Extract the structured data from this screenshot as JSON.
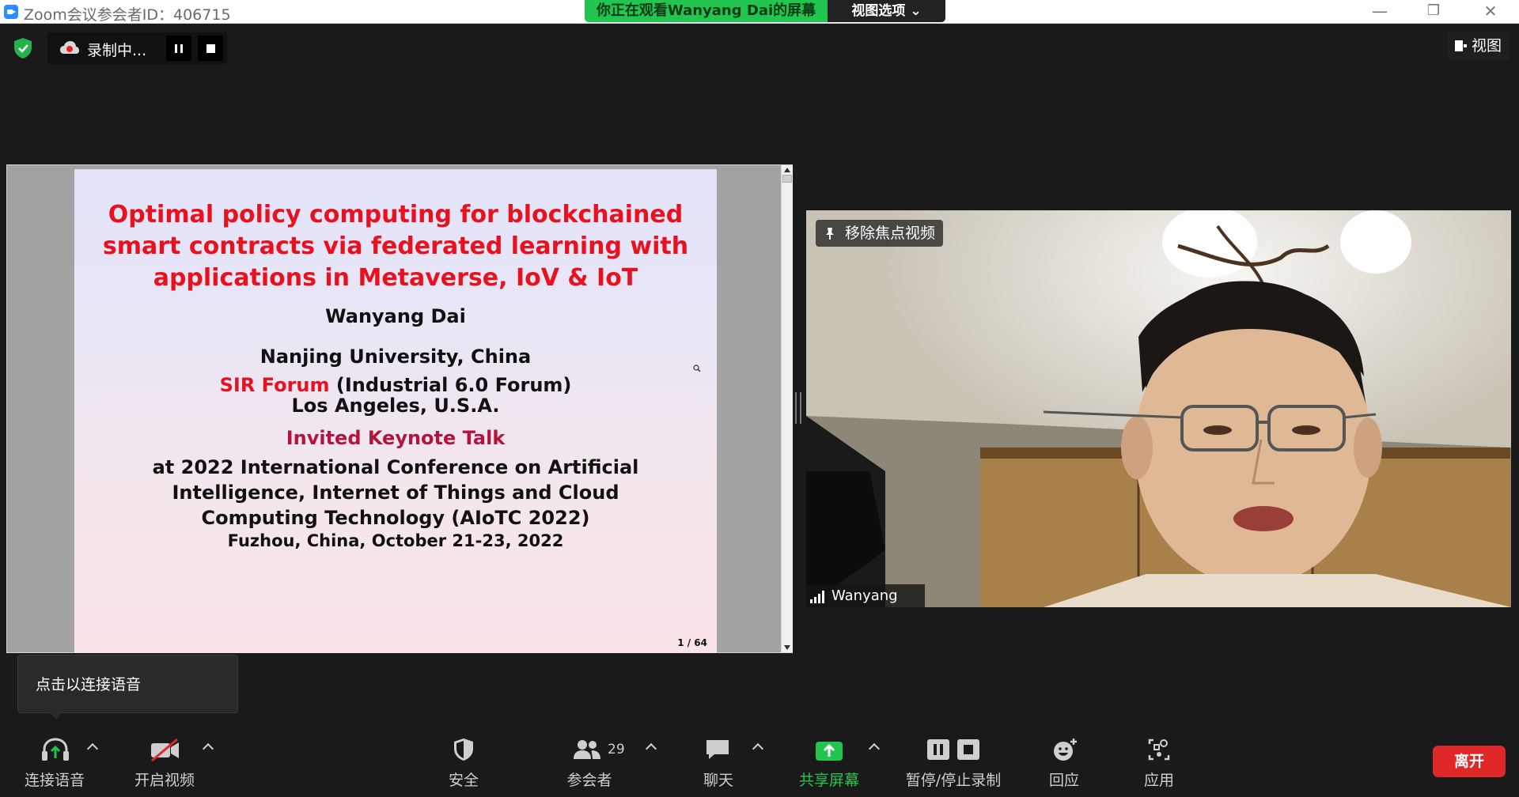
{
  "window": {
    "title": "Zoom会议参会者ID：406715",
    "minimize": "—",
    "restore": "❐",
    "close": "✕"
  },
  "share_banner": {
    "viewing_text": "你正在观看Wanyang  Dai的屏幕",
    "view_options": "视图选项 ⌄"
  },
  "recording": {
    "label": "录制中..."
  },
  "view_button": {
    "label": "视图"
  },
  "slide": {
    "title_lines": [
      "Optimal policy computing for blockchained",
      "smart contracts via federated learning with",
      "applications in Metaverse, IoV & IoT"
    ],
    "author": "Wanyang Dai",
    "affiliation": "Nanjing University, China",
    "forum_highlight": "SIR Forum",
    "forum_rest": " (Industrial 6.0 Forum)",
    "location": "Los Angeles, U.S.A.",
    "talk_type": "Invited Keynote Talk",
    "conference_lines": [
      "at 2022 International Conference on Artificial",
      "Intelligence, Internet of Things and Cloud",
      "Computing Technology (AIoTC 2022)"
    ],
    "venue": "Fuzhou, China, October 21-23, 2022",
    "page": "1 / 64"
  },
  "video": {
    "unpin_label": "移除焦点视频",
    "participant_name": "Wanyang Dai"
  },
  "tooltip": {
    "text": "点击以连接语音"
  },
  "toolbar": {
    "audio": "连接语音",
    "video": "开启视频",
    "security": "安全",
    "participants": "参会者",
    "participants_count": "29",
    "chat": "聊天",
    "share": "共享屏幕",
    "record": "暂停/停止录制",
    "reactions": "回应",
    "apps": "应用",
    "leave": "离开"
  },
  "colors": {
    "share_green": "#23c551",
    "slide_title_red": "#e8111e",
    "keynote_maroon": "#b4143c",
    "leave_red": "#e02828"
  }
}
